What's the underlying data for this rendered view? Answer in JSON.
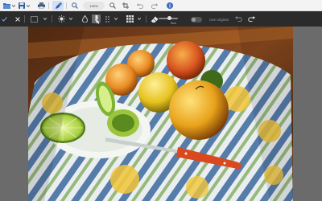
{
  "toolbar": {
    "zoom": "100%",
    "icons": [
      "folder-icon",
      "save-icon",
      "print-icon",
      "edit-pen-icon",
      "zoom-in-icon",
      "crop-icon",
      "undo-icon",
      "redo-icon",
      "info-icon"
    ]
  },
  "editbar": {
    "size_label": "Size",
    "use_original_label": "Use original",
    "accent": "#2b2b2b"
  },
  "photo": {
    "subject": "bowl-of-fruit-on-striped-cloth"
  }
}
